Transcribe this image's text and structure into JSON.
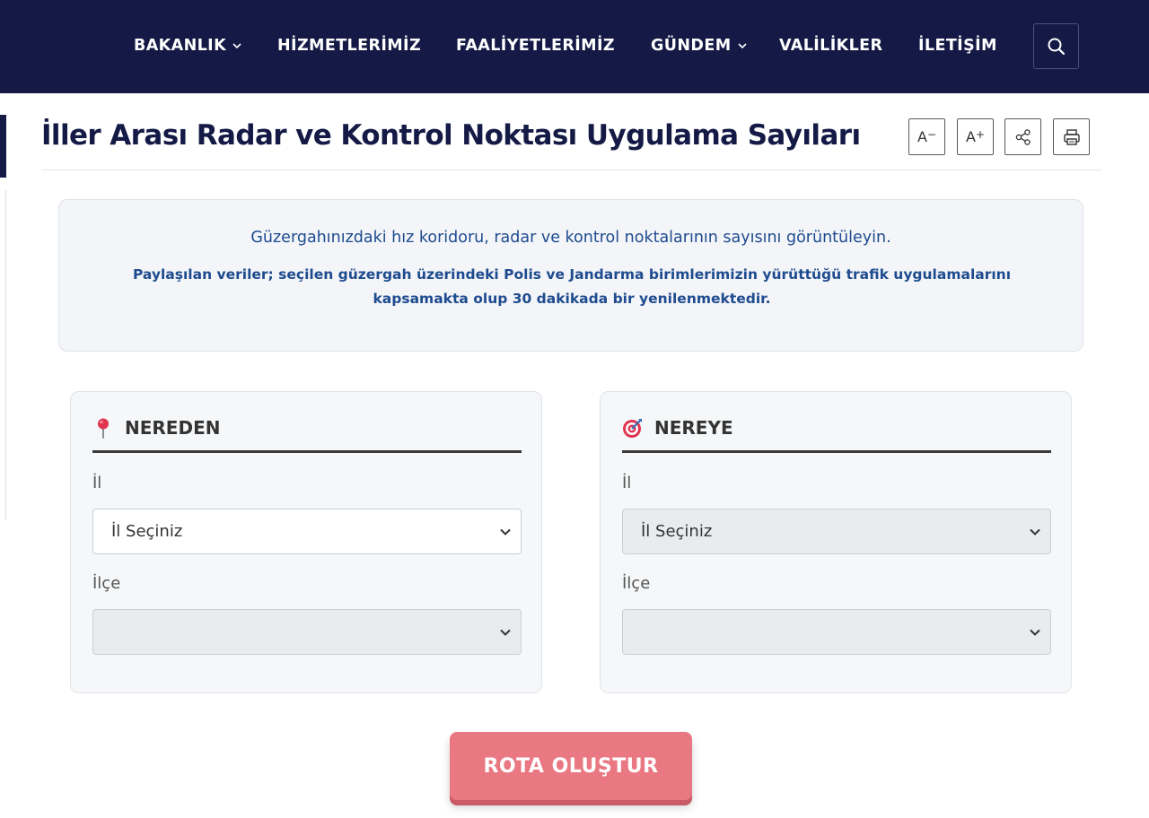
{
  "nav": {
    "items": [
      {
        "label": "BAKANLIK",
        "has_dropdown": true
      },
      {
        "label": "HİZMETLERİMİZ",
        "has_dropdown": false
      },
      {
        "label": "FAALİYETLERİMİZ",
        "has_dropdown": false
      },
      {
        "label": "GÜNDEM",
        "has_dropdown": true
      },
      {
        "label": "VALİLİKLER",
        "has_dropdown": false
      },
      {
        "label": "İLETİŞİM",
        "has_dropdown": false
      }
    ],
    "search_icon": "search-icon",
    "background": "#141a45"
  },
  "page": {
    "title": "İller Arası Radar ve Kontrol Noktası Uygulama Sayıları",
    "tools": {
      "decrease_font": "A",
      "decrease_font_sign": "−",
      "increase_font": "A",
      "increase_font_sign": "+",
      "share_icon": "share-icon",
      "print_icon": "print-icon"
    }
  },
  "info": {
    "line1": "Güzergahınızdaki hız koridoru, radar ve kontrol noktalarının sayısını görüntüleyin.",
    "line2": "Paylaşılan veriler; seçilen güzergah üzerindeki Polis ve Jandarma birimlerimizin yürüttüğü trafik uygulamalarını kapsamakta olup 30 dakikada bir yenilenmektedir.",
    "text_color": "#1e4b8f"
  },
  "from": {
    "title": "NEREDEN",
    "icon": "pin-icon",
    "province_label": "İl",
    "province_value": "İl Seçiniz",
    "district_label": "İlçe",
    "district_value": ""
  },
  "to": {
    "title": "NEREYE",
    "icon": "target-icon",
    "province_label": "İl",
    "province_value": "İl Seçiniz",
    "district_label": "İlçe",
    "district_value": ""
  },
  "action": {
    "route_button": "ROTA OLUŞTUR",
    "button_color": "#e97882"
  }
}
